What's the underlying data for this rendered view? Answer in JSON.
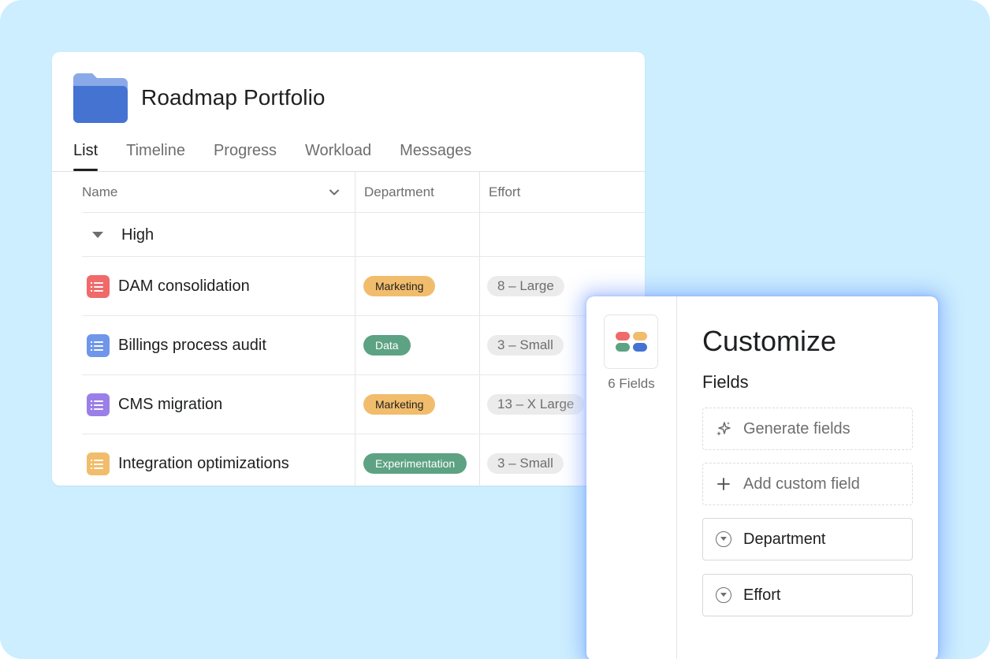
{
  "project": {
    "title": "Roadmap Portfolio",
    "folder_color": "#4573d2",
    "folder_tab_color": "#8aa9e8"
  },
  "tabs": [
    {
      "label": "List",
      "active": true
    },
    {
      "label": "Timeline",
      "active": false
    },
    {
      "label": "Progress",
      "active": false
    },
    {
      "label": "Workload",
      "active": false
    },
    {
      "label": "Messages",
      "active": false
    }
  ],
  "table": {
    "columns": [
      "Name",
      "Department",
      "Effort"
    ],
    "group": "High",
    "rows": [
      {
        "name": "DAM consolidation",
        "icon_color": "#f06a6a",
        "department": "Marketing",
        "dept_color": "#f1bd6c",
        "effort": "8 – Large"
      },
      {
        "name": "Billings process audit",
        "icon_color": "#6f96ea",
        "department": "Data",
        "dept_color": "#5da283",
        "effort": "3 – Small"
      },
      {
        "name": "CMS migration",
        "icon_color": "#9b7fe8",
        "department": "Marketing",
        "dept_color": "#f1bd6c",
        "effort": "13 – X Large"
      },
      {
        "name": "Integration optimizations",
        "icon_color": "#f1bd6c",
        "department": "Experimentation",
        "dept_color": "#5da283",
        "effort": "3 – Small"
      }
    ]
  },
  "customize": {
    "title": "Customize",
    "fields_count": "6 Fields",
    "section_label": "Fields",
    "generate_label": "Generate fields",
    "add_label": "Add custom field",
    "fields": [
      "Department",
      "Effort"
    ],
    "blob_colors": [
      "#f06a6a",
      "#f1bd6c",
      "#5da283",
      "#4573d2"
    ]
  }
}
